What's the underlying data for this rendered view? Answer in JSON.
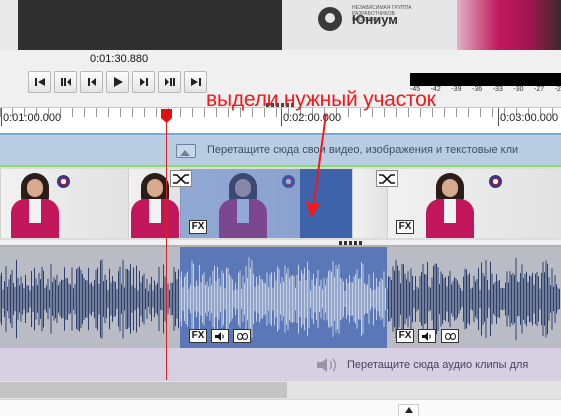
{
  "preview": {
    "logo_small": "НЕЗАВИСИМАЯ ГРУППА РАЗРАБОТЧИКОВ ПРОГРАММ",
    "logo_text": "Юниум",
    "timecode": "0:01:30.880"
  },
  "transport": {
    "buttons": [
      {
        "icon": "skip-to-start-icon"
      },
      {
        "icon": "previous-frame-icon"
      },
      {
        "icon": "rewind-icon"
      },
      {
        "icon": "play-icon"
      },
      {
        "icon": "forward-icon"
      },
      {
        "icon": "next-frame-icon"
      },
      {
        "icon": "skip-to-end-icon"
      }
    ]
  },
  "meter": {
    "ticks": [
      "-45",
      "-42",
      "-39",
      "-36",
      "-33",
      "-30",
      "-27",
      "-2"
    ]
  },
  "ruler": {
    "marks": [
      "0:01:00.000",
      "0:02:00.000",
      "0:03:00.000"
    ]
  },
  "video_track": {
    "drop_hint": "Перетащите сюда свои видео, изображения и текстовые кли",
    "fx_label": "FX"
  },
  "audio_track": {
    "drop_hint": "Перетащите сюда аудио клипы для",
    "fx_label": "FX"
  },
  "annotation": {
    "text": "выдели нужный участок",
    "color": "#f2181b"
  },
  "colors": {
    "selection": "#3f63aa",
    "playhead": "#d92020",
    "video_drop_bg": "#b9cde2",
    "audio_drop_bg": "#d7d0e2",
    "waveform": "#2d3f6e",
    "waveform_selected": "#c7cfe0"
  }
}
